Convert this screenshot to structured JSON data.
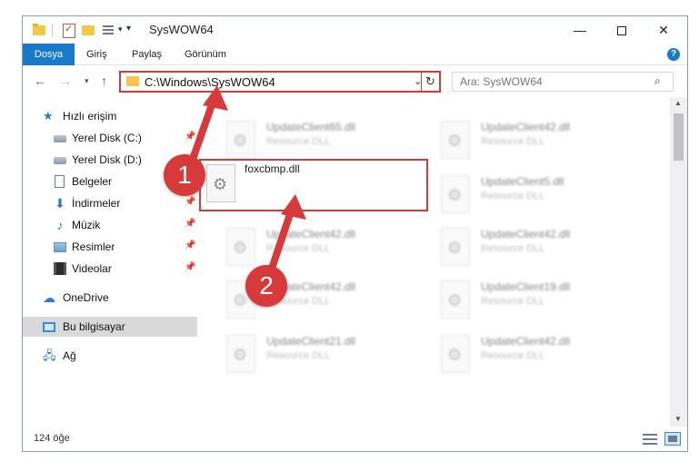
{
  "window": {
    "title": "SysWOW64"
  },
  "ribbon": {
    "tabs": [
      "Dosya",
      "Giriş",
      "Paylaş",
      "Görünüm"
    ]
  },
  "nav": {
    "address": "C:\\Windows\\SysWOW64",
    "search_placeholder": "Ara: SysWOW64"
  },
  "sidebar": {
    "items": [
      {
        "label": "Hızlı erişim",
        "icon": "star-icon"
      },
      {
        "label": "Yerel Disk (C:)",
        "icon": "disk-icon",
        "pinned": true
      },
      {
        "label": "Yerel Disk (D:)",
        "icon": "disk-icon",
        "pinned": true
      },
      {
        "label": "Belgeler",
        "icon": "document-icon",
        "pinned": true
      },
      {
        "label": "İndirmeler",
        "icon": "download-icon",
        "pinned": true
      },
      {
        "label": "Müzik",
        "icon": "music-icon",
        "pinned": true
      },
      {
        "label": "Resimler",
        "icon": "pictures-icon",
        "pinned": true
      },
      {
        "label": "Videolar",
        "icon": "video-icon",
        "pinned": true
      },
      {
        "label": "OneDrive",
        "icon": "cloud-icon"
      },
      {
        "label": "Bu bilgisayar",
        "icon": "computer-icon",
        "selected": true
      },
      {
        "label": "Ağ",
        "icon": "network-icon"
      }
    ]
  },
  "files": {
    "highlighted": {
      "name": "foxcbmp.dll"
    },
    "items": [
      {
        "name": "UpdateClient65.dll",
        "type": "Resource DLL"
      },
      {
        "name": "UpdateClient42.dll",
        "type": "Resource DLL"
      },
      {
        "name": "UpdateClient5.dll",
        "type": "Resource DLL"
      },
      {
        "name": "UpdateClient42.dll",
        "type": "Resource DLL"
      },
      {
        "name": "UpdateClient42.dll",
        "type": "Resource DLL"
      },
      {
        "name": "UpdateClient42.dll",
        "type": "Resource DLL"
      },
      {
        "name": "UpdateClient19.dll",
        "type": "Resource DLL"
      },
      {
        "name": "UpdateClient21.dll",
        "type": "Resource DLL"
      },
      {
        "name": "UpdateClient42.dll",
        "type": "Resource DLL"
      }
    ]
  },
  "status": {
    "count": "124 öğe"
  },
  "callouts": {
    "step1": "1",
    "step2": "2"
  },
  "colors": {
    "accent": "#1979ca",
    "highlight_red": "#d63a3a"
  }
}
